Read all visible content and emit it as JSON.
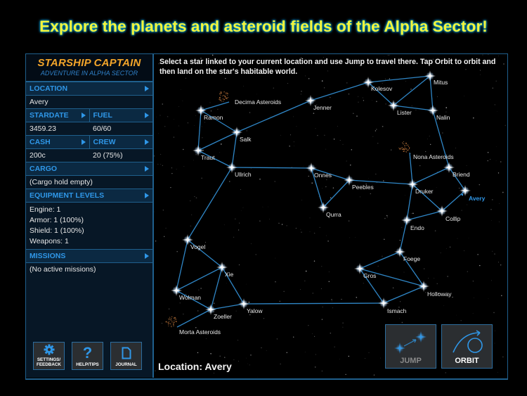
{
  "banner": {
    "text": "Explore the planets and asteroid fields of the Alpha Sector!"
  },
  "sidebar": {
    "logo_title": "STARSHIP CAPTAIN",
    "logo_subtitle": "ADVENTURE IN ALPHA SECTOR",
    "location": {
      "label": "LOCATION",
      "value": "Avery"
    },
    "stardate": {
      "label": "STARDATE",
      "value": "3459.23"
    },
    "fuel": {
      "label": "FUEL",
      "value": "60/60"
    },
    "cash": {
      "label": "CASH",
      "value": "200c"
    },
    "crew": {
      "label": "CREW",
      "value": "20 (75%)"
    },
    "cargo": {
      "label": "CARGO",
      "value": "(Cargo hold empty)"
    },
    "equipment": {
      "label": "EQUIPMENT LEVELS",
      "lines": [
        "Engine: 1",
        "Armor: 1 (100%)",
        "Shield: 1 (100%)",
        "Weapons: 1"
      ]
    },
    "missions": {
      "label": "MISSIONS",
      "value": "(No active missions)"
    },
    "buttons": {
      "settings": "SETTINGS/ FEEDBACK",
      "settings_l1": "SETTINGS/",
      "settings_l2": "FEEDBACK",
      "help": "HELP/TIPS",
      "journal": "JOURNAL"
    }
  },
  "map": {
    "instructions": "Select a star linked to your current location and use Jump to travel there. Tap Orbit to orbit and then land on the star's habitable world.",
    "location_readout": "Location: Avery",
    "current": "Avery",
    "colors": {
      "link": "#2f86c6",
      "current": "#2f97e8",
      "label": "#e8e8e8"
    },
    "stars": [
      {
        "name": "Ramon"
      },
      {
        "name": "Salk"
      },
      {
        "name": "Traut"
      },
      {
        "name": "Ullrich"
      },
      {
        "name": "Jenner"
      },
      {
        "name": "Kolesov"
      },
      {
        "name": "Mitus"
      },
      {
        "name": "Lister"
      },
      {
        "name": "Nalin"
      },
      {
        "name": "Onnes"
      },
      {
        "name": "Peebles"
      },
      {
        "name": "Qurra"
      },
      {
        "name": "Druker"
      },
      {
        "name": "Briend"
      },
      {
        "name": "Avery"
      },
      {
        "name": "Collip"
      },
      {
        "name": "Endo"
      },
      {
        "name": "Foege"
      },
      {
        "name": "Gros"
      },
      {
        "name": "Holloway"
      },
      {
        "name": "Ismach"
      },
      {
        "name": "Vogel"
      },
      {
        "name": "Xie"
      },
      {
        "name": "Wolman"
      },
      {
        "name": "Zoeller"
      },
      {
        "name": "Yalow"
      }
    ],
    "asteroids": [
      {
        "name": "Decima Asteroids"
      },
      {
        "name": "Nona Asteroids"
      },
      {
        "name": "Morta Asteroids"
      }
    ],
    "links": [
      [
        "Decima Asteroids",
        "Ramon"
      ],
      [
        "Ramon",
        "Salk"
      ],
      [
        "Ramon",
        "Traut"
      ],
      [
        "Traut",
        "Salk"
      ],
      [
        "Traut",
        "Ullrich"
      ],
      [
        "Salk",
        "Ullrich"
      ],
      [
        "Salk",
        "Jenner"
      ],
      [
        "Jenner",
        "Kolesov"
      ],
      [
        "Kolesov",
        "Mitus"
      ],
      [
        "Kolesov",
        "Lister"
      ],
      [
        "Lister",
        "Mitus"
      ],
      [
        "Lister",
        "Nalin"
      ],
      [
        "Mitus",
        "Nalin"
      ],
      [
        "Nalin",
        "Briend"
      ],
      [
        "Briend",
        "Avery"
      ],
      [
        "Briend",
        "Druker"
      ],
      [
        "Nona Asteroids",
        "Druker"
      ],
      [
        "Ullrich",
        "Onnes"
      ],
      [
        "Onnes",
        "Peebles"
      ],
      [
        "Onnes",
        "Qurra"
      ],
      [
        "Qurra",
        "Peebles"
      ],
      [
        "Peebles",
        "Druker"
      ],
      [
        "Druker",
        "Collip"
      ],
      [
        "Druker",
        "Endo"
      ],
      [
        "Collip",
        "Avery"
      ],
      [
        "Collip",
        "Endo"
      ],
      [
        "Endo",
        "Foege"
      ],
      [
        "Foege",
        "Gros"
      ],
      [
        "Foege",
        "Holloway"
      ],
      [
        "Gros",
        "Holloway"
      ],
      [
        "Gros",
        "Ismach"
      ],
      [
        "Ismach",
        "Holloway"
      ],
      [
        "Yalow",
        "Ismach"
      ],
      [
        "Ullrich",
        "Vogel"
      ],
      [
        "Vogel",
        "Xie"
      ],
      [
        "Vogel",
        "Wolman"
      ],
      [
        "Wolman",
        "Xie"
      ],
      [
        "Xie",
        "Zoeller"
      ],
      [
        "Xie",
        "Yalow"
      ],
      [
        "Wolman",
        "Zoeller"
      ],
      [
        "Zoeller",
        "Yalow"
      ],
      [
        "Zoeller",
        "Morta Asteroids"
      ]
    ]
  },
  "actions": {
    "jump": "JUMP",
    "orbit": "ORBIT",
    "jump_color": "#8a8a8a",
    "orbit_color": "#ffffff"
  }
}
